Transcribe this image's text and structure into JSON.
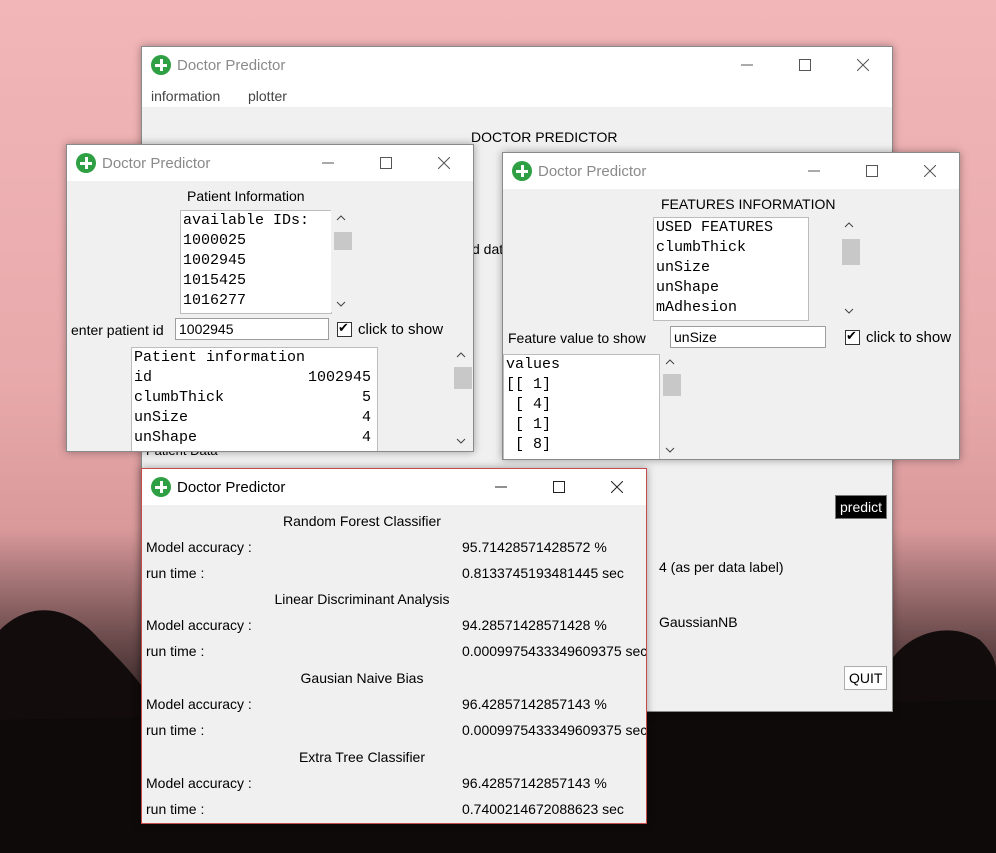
{
  "colors": {
    "accent_green": "#2ea043",
    "active_border": "#c64b4b"
  },
  "main": {
    "title": "Doctor Predictor",
    "menu": [
      "information",
      "plotter"
    ],
    "heading": "DOCTOR PREDICTOR",
    "partial_label": "d dat",
    "patient_data_label": "Patient Data",
    "predict_button": "predict",
    "prediction_result": "4 (as per data label)",
    "model_name": "GaussianNB",
    "quit_button": "QUIT"
  },
  "patient_win": {
    "title": "Doctor Predictor",
    "heading": "Patient Information",
    "ids_list": [
      "available IDs:",
      "1000025",
      "1002945",
      "1015425",
      "1016277"
    ],
    "id_label": "enter patient id",
    "id_value": "1002945",
    "checkbox_label": "click to show",
    "info_rows": [
      {
        "key": "Patient information",
        "val": ""
      },
      {
        "key": "id",
        "val": "1002945"
      },
      {
        "key": "clumbThick",
        "val": "5"
      },
      {
        "key": "unSize",
        "val": "4"
      },
      {
        "key": "unShape",
        "val": "4"
      }
    ]
  },
  "features_win": {
    "title": "Doctor Predictor",
    "heading": "FEATURES INFORMATION",
    "features_list": [
      "USED FEATURES",
      "clumbThick",
      "unSize",
      "unShape",
      "mAdhesion"
    ],
    "feature_label": "Feature value to show",
    "feature_value": "unSize",
    "checkbox_label": "click to show",
    "values_list": [
      "values",
      "[[ 1]",
      " [ 4]",
      " [ 1]",
      " [ 8]"
    ]
  },
  "results_win": {
    "title": "Doctor Predictor",
    "sections": [
      {
        "name": "Random Forest Classifier",
        "accuracy_label": "Model accuracy :",
        "accuracy": "95.71428571428572 %",
        "runtime_label": "run time :",
        "runtime": "0.8133745193481445 sec"
      },
      {
        "name": "Linear Discriminant Analysis",
        "accuracy_label": "Model accuracy :",
        "accuracy": "94.28571428571428 %",
        "runtime_label": "run time :",
        "runtime": "0.0009975433349609375 sec"
      },
      {
        "name": "Gausian Naive Bias",
        "accuracy_label": "Model accuracy :",
        "accuracy": "96.42857142857143 %",
        "runtime_label": "run time :",
        "runtime": "0.0009975433349609375 sec"
      },
      {
        "name": "Extra Tree Classifier",
        "accuracy_label": "Model accuracy :",
        "accuracy": "96.42857142857143 %",
        "runtime_label": "run time :",
        "runtime": "0.7400214672088623 sec"
      }
    ]
  }
}
